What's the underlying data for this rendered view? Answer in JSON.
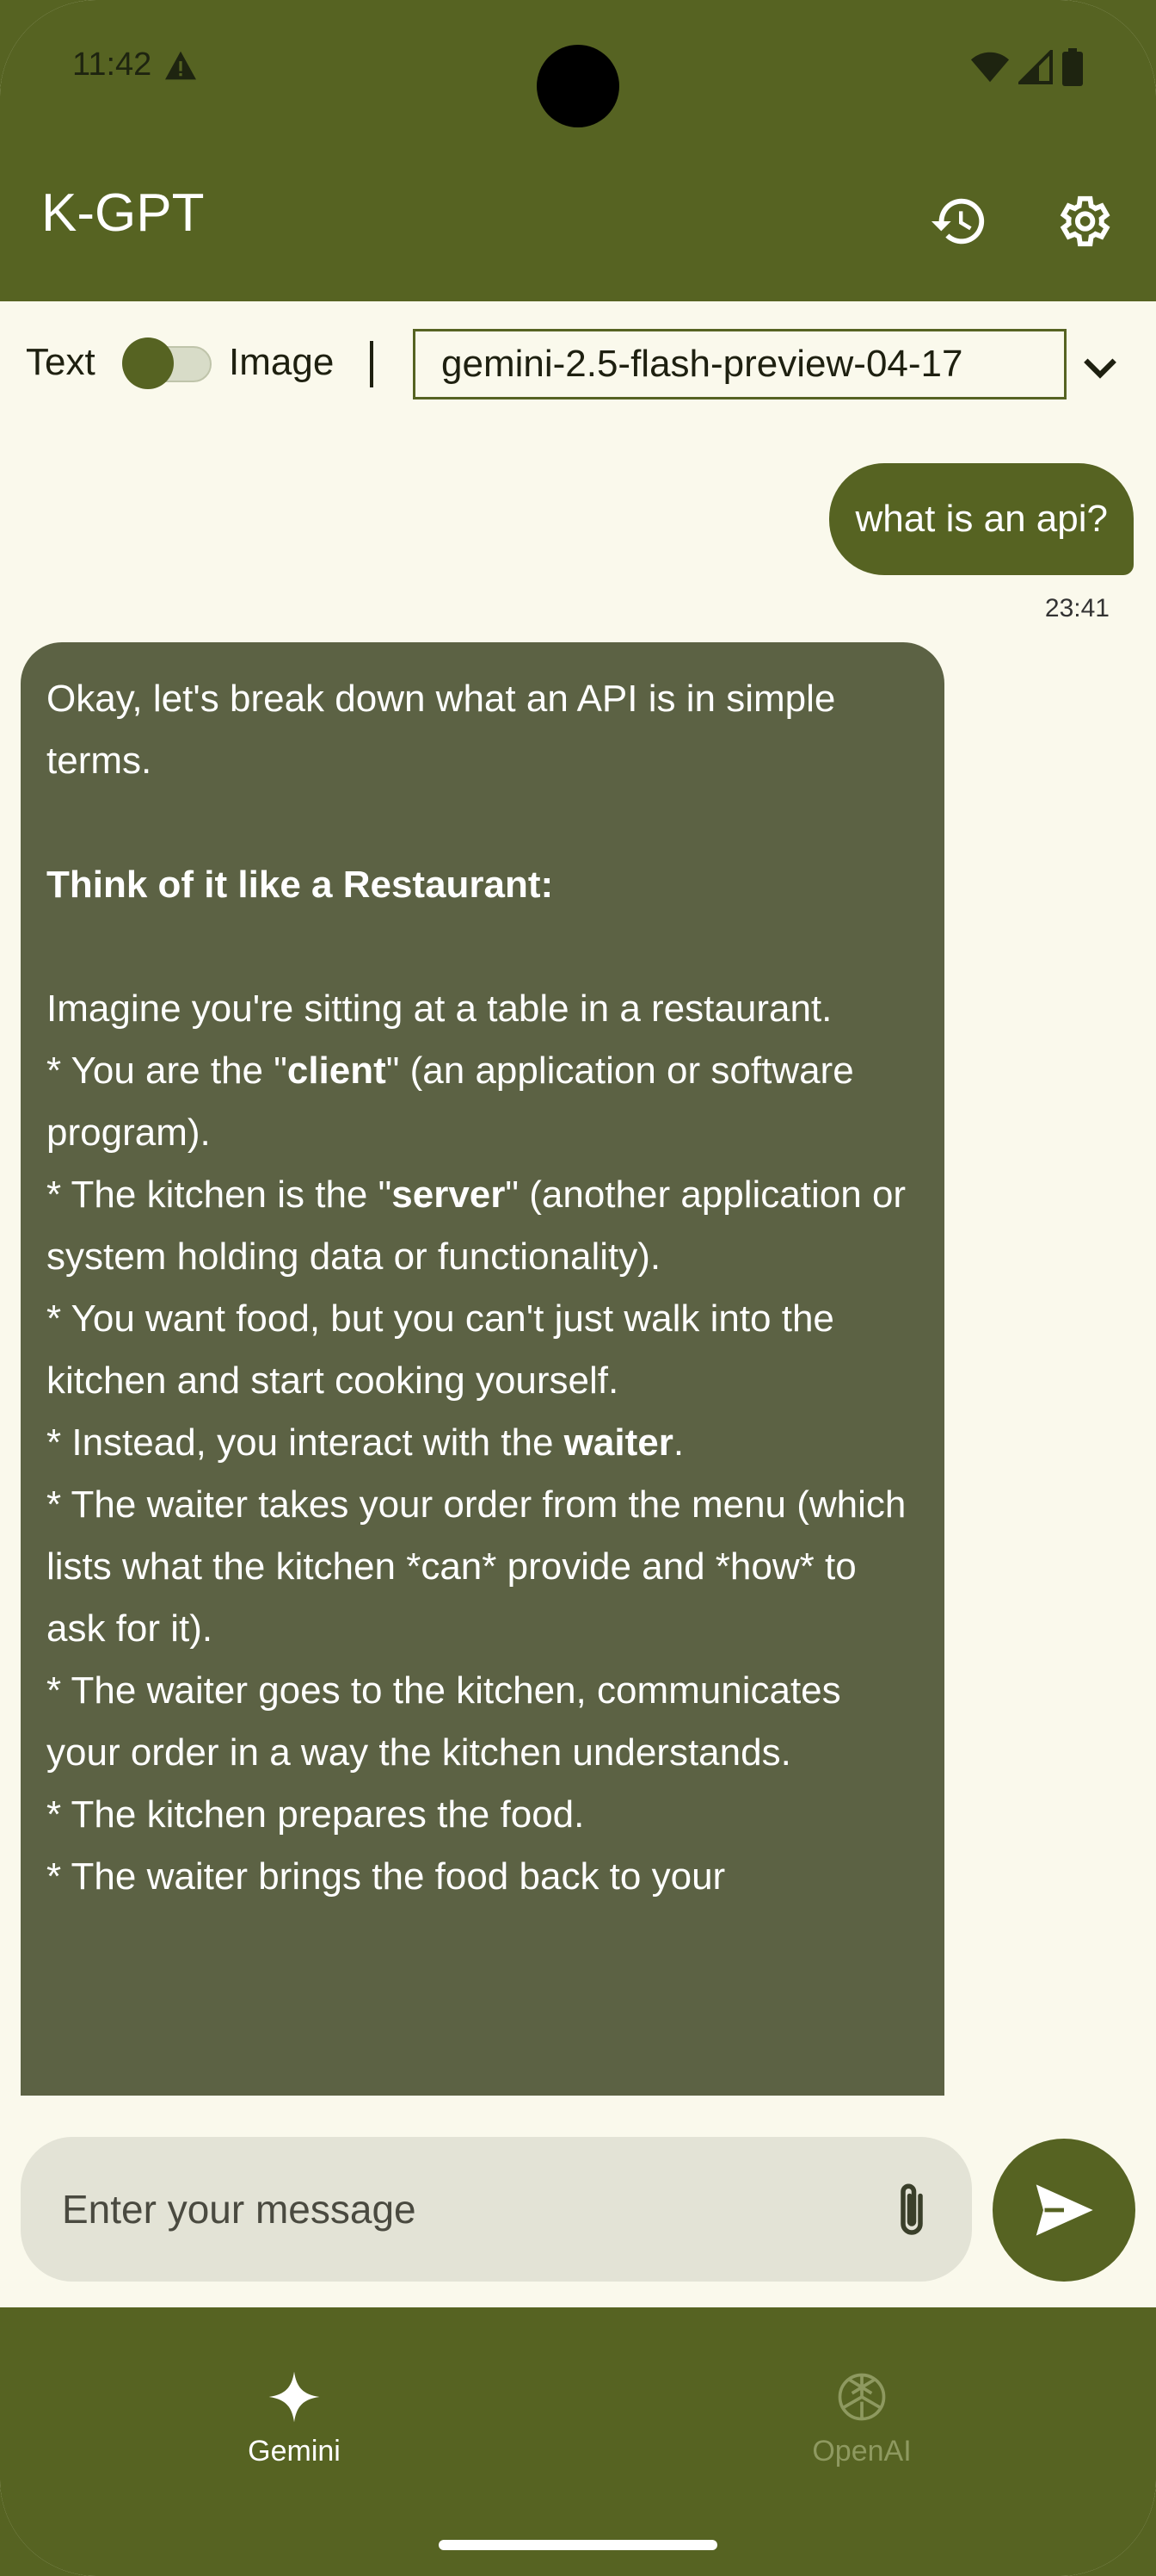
{
  "status_bar": {
    "time": "11:42"
  },
  "app_bar": {
    "title": "K-GPT"
  },
  "mode_toggle": {
    "left_label": "Text",
    "right_label": "Image",
    "separator": "|"
  },
  "model_select": {
    "value": "gemini-2.5-flash-preview-04-17"
  },
  "chat": {
    "user_message": "what is an api?",
    "user_timestamp": "23:41",
    "bot_lines": {
      "l1": "Okay, let's break down what an API is in simple terms.",
      "l2": "Think of it like a Restaurant:",
      "l3": "Imagine you're sitting at a table in a restaurant.",
      "l4a": "*   You are the \"",
      "l4b": "client",
      "l4c": "\" (an application or software program).",
      "l5a": "*   The kitchen is the \"",
      "l5b": "server",
      "l5c": "\" (another application or system holding data or functionality).",
      "l6": "*   You want food, but you can't just walk into the kitchen and start cooking yourself.",
      "l7a": "*   Instead, you interact with the ",
      "l7b": "waiter",
      "l7c": ".",
      "l8": "*   The waiter takes your order from the menu (which lists what the kitchen *can* provide and *how* to ask for it).",
      "l9": "*   The waiter goes to the kitchen, communicates your order in a way the kitchen understands.",
      "l10": "*   The kitchen prepares the food.",
      "l11": "*   The waiter brings the food back to your"
    }
  },
  "composer": {
    "placeholder": "Enter your message"
  },
  "bottom_nav": {
    "gemini_label": "Gemini",
    "openai_label": "OpenAI"
  },
  "colors": {
    "primary": "#566322",
    "background": "#FAF9EC",
    "bot_bubble": "#5C6244",
    "input_bg": "#E3E3D6"
  }
}
